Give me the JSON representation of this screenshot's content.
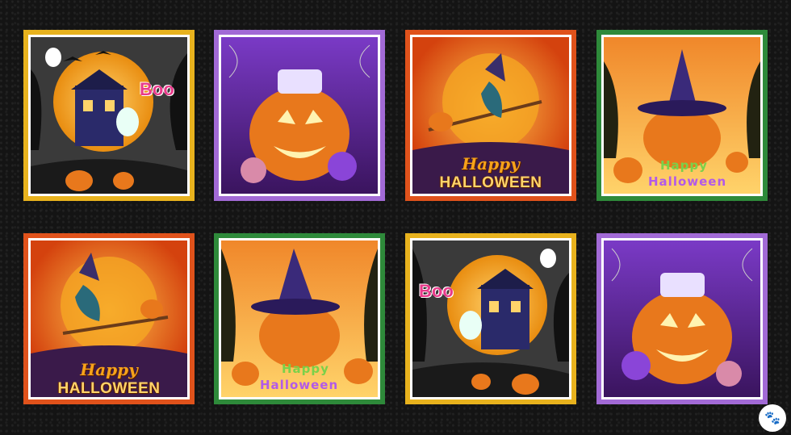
{
  "panels": {
    "p1_text": "Boo",
    "p3_happy": "Happy",
    "p3_halloween": "HALLOWEEN",
    "p4_happy": "Happy",
    "p4_halloween": "Halloween",
    "p5_happy": "Happy",
    "p5_halloween": "HALLOWEEN",
    "p6_happy": "Happy",
    "p6_halloween": "Halloween",
    "p7_text": "Boo"
  },
  "logo": {
    "icon": "paw-icon"
  },
  "colors": {
    "background": "#141414",
    "border_yellow": "#e8b21d",
    "border_purple": "#a26ad6",
    "border_orange": "#e0521b",
    "border_green": "#2e8a3a",
    "moon": "#f5a623",
    "pumpkin": "#e8781c",
    "sky_purple": "#6a2fb0"
  }
}
